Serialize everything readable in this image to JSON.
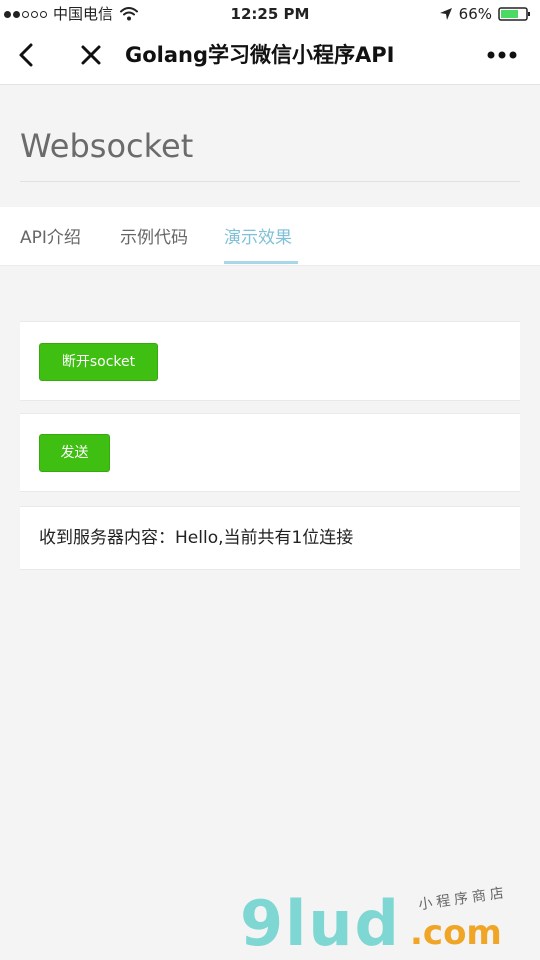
{
  "status_bar": {
    "carrier": "中国电信",
    "time": "12:25 PM",
    "battery": "66%"
  },
  "nav": {
    "title": "Golang学习微信小程序API"
  },
  "header": {
    "title": "Websocket"
  },
  "tabs": [
    {
      "label": "API介绍",
      "active": false
    },
    {
      "label": "示例代码",
      "active": false
    },
    {
      "label": "演示效果",
      "active": true
    }
  ],
  "actions": {
    "disconnect_label": "断开socket",
    "send_label": "发送"
  },
  "message": {
    "received_text": "收到服务器内容：Hello,当前共有1位连接"
  },
  "watermark": {
    "logo": "9lud",
    "domain": ".com",
    "slogan": "小程序商店"
  },
  "colors": {
    "accent": "#7fc1d8",
    "button_green": "#3fbf12",
    "background": "#f4f4f4"
  }
}
